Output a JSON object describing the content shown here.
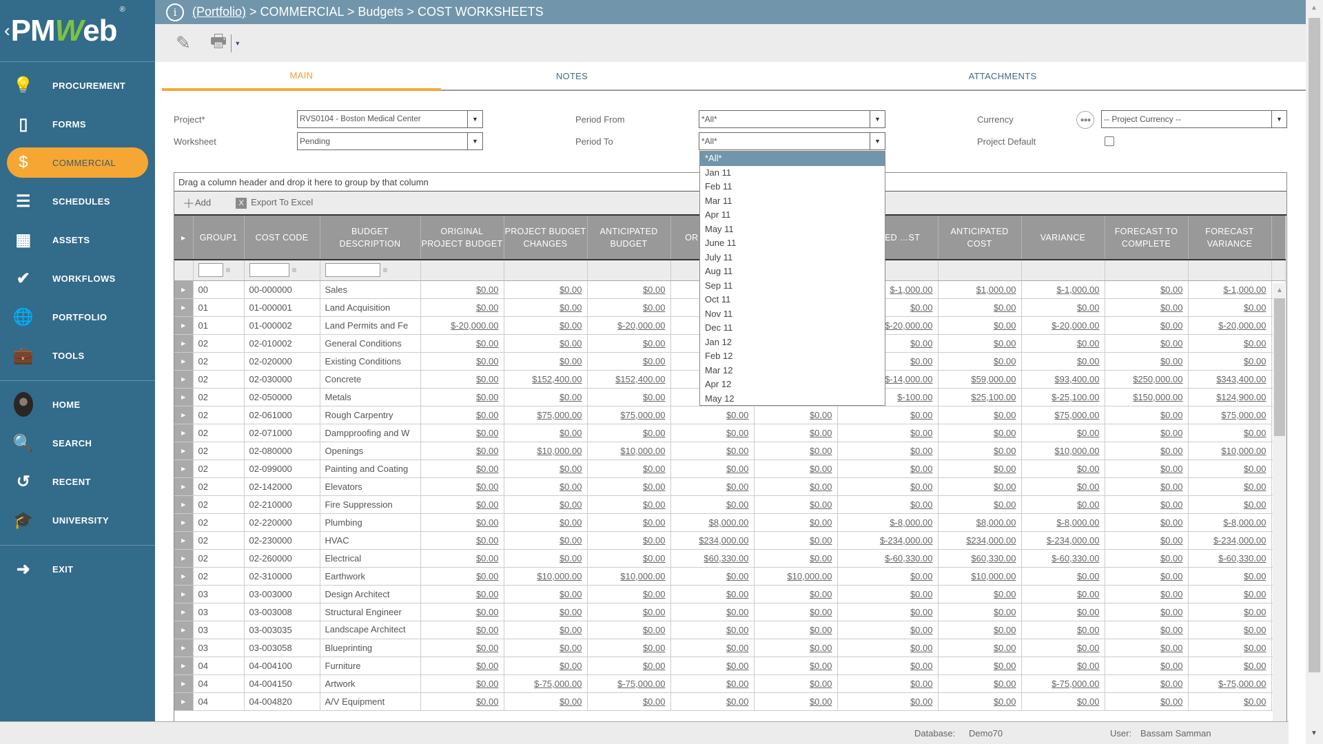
{
  "sidebar": {
    "logo": {
      "pre": "PM",
      "w": "W",
      "post": "eb",
      "reg": "®"
    },
    "modules": [
      {
        "label": "PROCUREMENT",
        "icon": "lightbulb-icon",
        "glyph": "💡"
      },
      {
        "label": "FORMS",
        "icon": "document-icon",
        "glyph": "▯"
      },
      {
        "label": "COMMERCIAL",
        "icon": "dollar-icon",
        "glyph": "$",
        "active": true
      },
      {
        "label": "SCHEDULES",
        "icon": "gantt-icon",
        "glyph": "☰"
      },
      {
        "label": "ASSETS",
        "icon": "building-icon",
        "glyph": "▦"
      },
      {
        "label": "WORKFLOWS",
        "icon": "checkmark-icon",
        "glyph": "✔"
      },
      {
        "label": "PORTFOLIO",
        "icon": "globe-icon",
        "glyph": "🌐"
      },
      {
        "label": "TOOLS",
        "icon": "toolbox-icon",
        "glyph": "💼"
      }
    ],
    "personal": [
      {
        "label": "HOME",
        "icon": "avatar"
      },
      {
        "label": "SEARCH",
        "icon": "search-icon",
        "glyph": "🔍"
      },
      {
        "label": "RECENT",
        "icon": "history-icon",
        "glyph": "↺"
      },
      {
        "label": "UNIVERSITY",
        "icon": "graduation-cap-icon",
        "glyph": "🎓"
      }
    ],
    "exit": {
      "label": "EXIT",
      "icon": "exit-icon",
      "glyph": "➜"
    }
  },
  "breadcrumb": {
    "root": "(Portfolio)",
    "rest": " > COMMERCIAL > Budgets > COST WORKSHEETS"
  },
  "toolbar": {
    "edit_icon": "✎",
    "print_icon": "🖶",
    "caret": "▼"
  },
  "tabs": [
    {
      "label": "MAIN",
      "active": true
    },
    {
      "label": "NOTES"
    },
    {
      "label": "ATTACHMENTS"
    }
  ],
  "form": {
    "project_label": "Project*",
    "project_value": "RVS0104 - Boston Medical Center",
    "worksheet_label": "Worksheet",
    "worksheet_value": "Pending",
    "period_from_label": "Period From",
    "period_from_value": "*All*",
    "period_to_label": "Period To",
    "period_to_value": "*All*",
    "currency_label": "Currency",
    "currency_value": "-- Project Currency --",
    "project_default_label": "Project Default",
    "project_default_checked": false
  },
  "period_to_options": [
    "*All*",
    "Jan 11",
    "Feb 11",
    "Mar 11",
    "Apr 11",
    "May 11",
    "June 11",
    "July 11",
    "Aug 11",
    "Sep 11",
    "Oct 11",
    "Nov 11",
    "Dec 11",
    "Jan 12",
    "Feb 12",
    "Mar 12",
    "Apr 12",
    "May 12"
  ],
  "grid": {
    "group_hint": "Drag a column header and drop it here to group by that column",
    "add_label": "Add",
    "export_label": "Export To Excel",
    "columns": [
      "GROUP1",
      "COST CODE",
      "BUDGET DESCRIPTION",
      "ORIGINAL PROJECT BUDGET",
      "PROJECT BUDGET CHANGES",
      "ANTICIPATED BUDGET",
      "OR… COM…",
      "",
      "…MITTED …ST",
      "ANTICIPATED COST",
      "VARIANCE",
      "FORECAST TO COMPLETE",
      "FORECAST VARIANCE"
    ],
    "rows": [
      [
        "00",
        "00-000000",
        "Sales",
        "$0.00",
        "$0.00",
        "$0.00",
        "",
        "",
        "$-1,000.00",
        "$1,000.00",
        "$-1,000.00",
        "$0.00",
        "$-1,000.00"
      ],
      [
        "01",
        "01-000001",
        "Land Acquisition",
        "$0.00",
        "$0.00",
        "$0.00",
        "",
        "",
        "$0.00",
        "$0.00",
        "$0.00",
        "$0.00",
        "$0.00"
      ],
      [
        "01",
        "01-000002",
        "Land Permits and Fe",
        "$-20,000.00",
        "$0.00",
        "$-20,000.00",
        "",
        "",
        "$-20,000.00",
        "$0.00",
        "$-20,000.00",
        "$0.00",
        "$-20,000.00"
      ],
      [
        "02",
        "02-010002",
        "General Conditions",
        "$0.00",
        "$0.00",
        "$0.00",
        "",
        "",
        "$0.00",
        "$0.00",
        "$0.00",
        "$0.00",
        "$0.00"
      ],
      [
        "02",
        "02-020000",
        "Existing Conditions",
        "$0.00",
        "$0.00",
        "$0.00",
        "",
        "",
        "$0.00",
        "$0.00",
        "$0.00",
        "$0.00",
        "$0.00"
      ],
      [
        "02",
        "02-030000",
        "Concrete",
        "$0.00",
        "$152,400.00",
        "$152,400.00",
        "",
        "",
        "$-14,000.00",
        "$59,000.00",
        "$93,400.00",
        "$250,000.00",
        "$343,400.00"
      ],
      [
        "02",
        "02-050000",
        "Metals",
        "$0.00",
        "$0.00",
        "$0.00",
        "",
        "",
        "$-100.00",
        "$25,100.00",
        "$-25,100.00",
        "$150,000.00",
        "$124,900.00"
      ],
      [
        "02",
        "02-061000",
        "Rough Carpentry",
        "$0.00",
        "$75,000.00",
        "$75,000.00",
        "$0.00",
        "$0.00",
        "$0.00",
        "$0.00",
        "$75,000.00",
        "$0.00",
        "$75,000.00"
      ],
      [
        "02",
        "02-071000",
        "Dampproofing and W",
        "$0.00",
        "$0.00",
        "$0.00",
        "$0.00",
        "$0.00",
        "$0.00",
        "$0.00",
        "$0.00",
        "$0.00",
        "$0.00"
      ],
      [
        "02",
        "02-080000",
        "Openings",
        "$0.00",
        "$10,000.00",
        "$10,000.00",
        "$0.00",
        "$0.00",
        "$0.00",
        "$0.00",
        "$10,000.00",
        "$0.00",
        "$10,000.00"
      ],
      [
        "02",
        "02-099000",
        "Painting and Coating",
        "$0.00",
        "$0.00",
        "$0.00",
        "$0.00",
        "$0.00",
        "$0.00",
        "$0.00",
        "$0.00",
        "$0.00",
        "$0.00"
      ],
      [
        "02",
        "02-142000",
        "Elevators",
        "$0.00",
        "$0.00",
        "$0.00",
        "$0.00",
        "$0.00",
        "$0.00",
        "$0.00",
        "$0.00",
        "$0.00",
        "$0.00"
      ],
      [
        "02",
        "02-210000",
        "Fire Suppression",
        "$0.00",
        "$0.00",
        "$0.00",
        "$0.00",
        "$0.00",
        "$0.00",
        "$0.00",
        "$0.00",
        "$0.00",
        "$0.00"
      ],
      [
        "02",
        "02-220000",
        "Plumbing",
        "$0.00",
        "$0.00",
        "$0.00",
        "$8,000.00",
        "$0.00",
        "$-8,000.00",
        "$8,000.00",
        "$-8,000.00",
        "$0.00",
        "$-8,000.00"
      ],
      [
        "02",
        "02-230000",
        "HVAC",
        "$0.00",
        "$0.00",
        "$0.00",
        "$234,000.00",
        "$0.00",
        "$-234,000.00",
        "$234,000.00",
        "$-234,000.00",
        "$0.00",
        "$-234,000.00"
      ],
      [
        "02",
        "02-260000",
        "Electrical",
        "$0.00",
        "$0.00",
        "$0.00",
        "$60,330.00",
        "$0.00",
        "$-60,330.00",
        "$60,330.00",
        "$-60,330.00",
        "$0.00",
        "$-60,330.00"
      ],
      [
        "02",
        "02-310000",
        "Earthwork",
        "$0.00",
        "$10,000.00",
        "$10,000.00",
        "$0.00",
        "$10,000.00",
        "$0.00",
        "$10,000.00",
        "$0.00",
        "$0.00",
        "$0.00"
      ],
      [
        "03",
        "03-003000",
        "Design Architect",
        "$0.00",
        "$0.00",
        "$0.00",
        "$0.00",
        "$0.00",
        "$0.00",
        "$0.00",
        "$0.00",
        "$0.00",
        "$0.00"
      ],
      [
        "03",
        "03-003008",
        "Structural Engineer",
        "$0.00",
        "$0.00",
        "$0.00",
        "$0.00",
        "$0.00",
        "$0.00",
        "$0.00",
        "$0.00",
        "$0.00",
        "$0.00"
      ],
      [
        "03",
        "03-003035",
        "Landscape Architect",
        "$0.00",
        "$0.00",
        "$0.00",
        "$0.00",
        "$0.00",
        "$0.00",
        "$0.00",
        "$0.00",
        "$0.00",
        "$0.00"
      ],
      [
        "03",
        "03-003058",
        "Blueprinting",
        "$0.00",
        "$0.00",
        "$0.00",
        "$0.00",
        "$0.00",
        "$0.00",
        "$0.00",
        "$0.00",
        "$0.00",
        "$0.00"
      ],
      [
        "04",
        "04-004100",
        "Furniture",
        "$0.00",
        "$0.00",
        "$0.00",
        "$0.00",
        "$0.00",
        "$0.00",
        "$0.00",
        "$0.00",
        "$0.00",
        "$0.00"
      ],
      [
        "04",
        "04-004150",
        "Artwork",
        "$0.00",
        "$-75,000.00",
        "$-75,000.00",
        "$0.00",
        "$0.00",
        "$0.00",
        "$0.00",
        "$-75,000.00",
        "$0.00",
        "$-75,000.00"
      ],
      [
        "04",
        "04-004820",
        "A/V Equipment",
        "$0.00",
        "$0.00",
        "$0.00",
        "$0.00",
        "$0.00",
        "$0.00",
        "$0.00",
        "$0.00",
        "$0.00",
        "$0.00"
      ]
    ]
  },
  "status": {
    "database_label": "Database:",
    "database_value": "Demo70",
    "user_label": "User:",
    "user_value": "Bassam Samman"
  },
  "colors": {
    "sidebar": "#336b8a",
    "accent": "#f6a733",
    "topbar": "#7196ab"
  }
}
